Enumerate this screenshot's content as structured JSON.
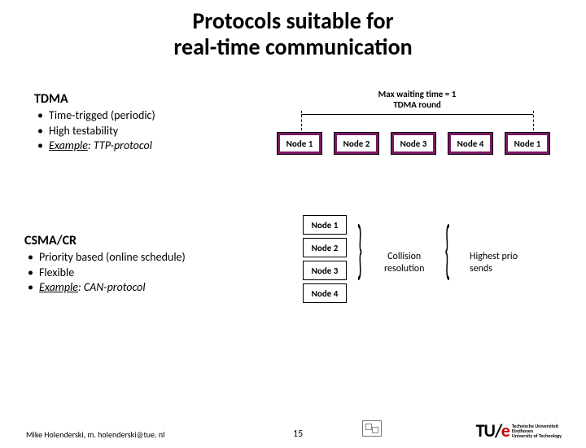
{
  "title_l1": "Protocols suitable for",
  "title_l2": "real-time communication",
  "tdma": {
    "heading": "TDMA",
    "items": [
      "Time-trigged (periodic)",
      "High testability"
    ],
    "ex_label": "Example",
    "ex_value": ": TTP-protocol",
    "timeline_l1": "Max waiting time = 1",
    "timeline_l2": "TDMA round",
    "nodes": [
      "Node 1",
      "Node 2",
      "Node 3",
      "Node 4",
      "Node 1"
    ]
  },
  "csma": {
    "heading": "CSMA/CR",
    "items": [
      "Priority based (online schedule)",
      "Flexible"
    ],
    "ex_label": "Example",
    "ex_value": ": CAN-protocol",
    "nodes": [
      "Node 1",
      "Node 2",
      "Node 3",
      "Node 4"
    ],
    "col_l1": "Collision",
    "col_l2": "resolution",
    "prio_l1": "Highest prio",
    "prio_l2": "sends"
  },
  "footer": {
    "note": "Mike Holenderski, m. holenderski@tue. nl",
    "page": "15",
    "logo_main": "TU/",
    "logo_e": "e",
    "logo_sub1": "Technische Universiteit",
    "logo_sub2": "Eindhoven",
    "logo_sub3": "University of Technology"
  }
}
